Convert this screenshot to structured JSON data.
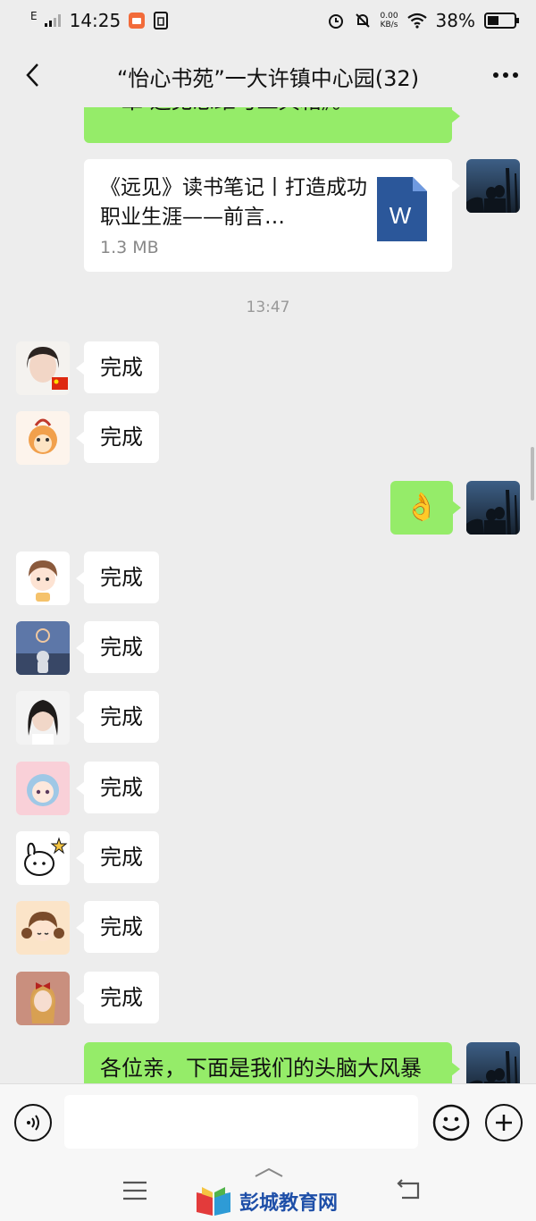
{
  "status_bar": {
    "network": "E",
    "time": "14:25",
    "net_speed_value": "0.00",
    "net_speed_unit": "KB/s",
    "battery": "38%"
  },
  "header": {
    "title": "“怡心书苑”一大许镇中心园(32)"
  },
  "messages": {
    "top_fragment": "一章 远见思维与工具箱》。",
    "file": {
      "name": "《远见》读书笔记丨打造成功职业生涯——前言…",
      "size": "1.3 MB",
      "icon_letter": "W"
    },
    "timestamp": "13:47",
    "done_label": "完成",
    "ok_emoji": "👌",
    "last_message": "各位亲，下面是我们的头脑大风暴"
  },
  "input": {
    "placeholder": ""
  },
  "watermark": {
    "text": "彭城教育网"
  },
  "colors": {
    "background": "#ededed",
    "bubble_green": "#95ec69",
    "bubble_white": "#ffffff",
    "word_blue": "#2b579a"
  }
}
